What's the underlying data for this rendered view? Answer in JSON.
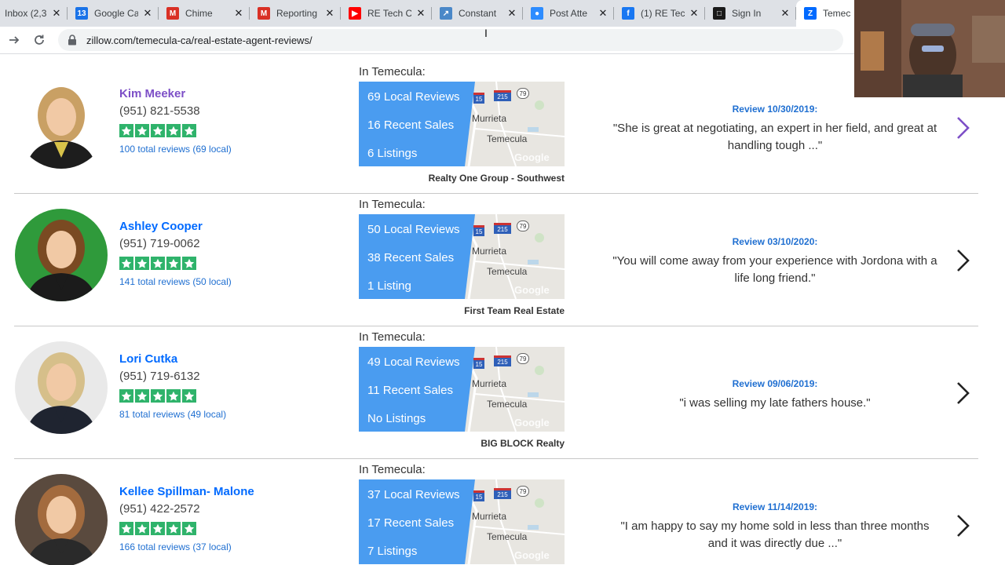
{
  "browser": {
    "tabs": [
      {
        "title": "Inbox (2,3",
        "icon": "gmail-icon",
        "color": "#d93025"
      },
      {
        "title": "Google Ca",
        "icon": "google-calendar-icon",
        "color": "#1a73e8",
        "glyph": "13"
      },
      {
        "title": "Chime",
        "icon": "gmail-icon",
        "color": "#d93025",
        "glyph": "M"
      },
      {
        "title": "Reporting",
        "icon": "gmail-icon",
        "color": "#d93025",
        "glyph": "M"
      },
      {
        "title": "RE Tech C",
        "icon": "youtube-icon",
        "color": "#ff0000",
        "glyph": "▶"
      },
      {
        "title": "Constant",
        "icon": "constant-contact-icon",
        "color": "#4a88c8",
        "glyph": "↗"
      },
      {
        "title": "Post Atte",
        "icon": "zoom-icon",
        "color": "#2d8cff",
        "glyph": "●"
      },
      {
        "title": "(1) RE Tec",
        "icon": "facebook-icon",
        "color": "#1877f2",
        "glyph": "f"
      },
      {
        "title": "Sign In",
        "icon": "square-icon",
        "color": "#1a1a1a",
        "glyph": "□"
      },
      {
        "title": "Temec",
        "icon": "zillow-icon",
        "color": "#006aff",
        "glyph": "Z"
      }
    ],
    "url": "zillow.com/temecula-ca/real-estate-agent-reviews/"
  },
  "agents": [
    {
      "name": "Kim Meeker",
      "visited": true,
      "phone": "(951) 821-5538",
      "rating": 5,
      "total_reviews": "100 total reviews (69 local)",
      "in_city": "In Temecula:",
      "stats": [
        "69 Local Reviews",
        "16 Recent Sales",
        "6 Listings"
      ],
      "broker": "Realty One Group - Southwest",
      "review_date": "Review 10/30/2019:",
      "review_text": "\"She is great at negotiating, an expert in her field, and great at handling tough ...\"",
      "chevron_color": "#7d4fc7"
    },
    {
      "name": "Ashley Cooper",
      "visited": false,
      "phone": "(951) 719-0062",
      "rating": 5,
      "total_reviews": "141 total reviews (50 local)",
      "in_city": "In Temecula:",
      "stats": [
        "50 Local Reviews",
        "38 Recent Sales",
        "1 Listing"
      ],
      "broker": "First Team Real Estate",
      "review_date": "Review 03/10/2020:",
      "review_text": "\"You will come away from your experience with Jordona with a life long friend.\"",
      "chevron_color": "#222222"
    },
    {
      "name": "Lori Cutka",
      "visited": false,
      "phone": "(951) 719-6132",
      "rating": 5,
      "total_reviews": "81 total reviews (49 local)",
      "in_city": "In Temecula:",
      "stats": [
        "49 Local Reviews",
        "11 Recent Sales",
        "No Listings"
      ],
      "broker": "BIG BLOCK Realty",
      "review_date": "Review 09/06/2019:",
      "review_text": "\"i was selling my late fathers house.\"",
      "chevron_color": "#222222"
    },
    {
      "name": "Kellee Spillman- Malone",
      "visited": false,
      "phone": "(951) 422-2572",
      "rating": 5,
      "total_reviews": "166 total reviews (37 local)",
      "in_city": "In Temecula:",
      "stats": [
        "37 Local Reviews",
        "17 Recent Sales",
        "7 Listings"
      ],
      "broker": "",
      "review_date": "Review 11/14/2019:",
      "review_text": "\"I am happy to say my home sold in less than three months and it was directly due ...\"",
      "chevron_color": "#222222"
    }
  ],
  "map_labels": {
    "city_1": "Murrieta",
    "city_2": "Temecula",
    "highway_15": "15",
    "highway_215": "215",
    "highway_79": "79",
    "watermark": "Google"
  },
  "colors": {
    "zillow_blue": "#006aff",
    "visited_purple": "#7d4fc7",
    "star_green": "#2fb36b",
    "stat_panel_blue": "#4a9cf0"
  }
}
